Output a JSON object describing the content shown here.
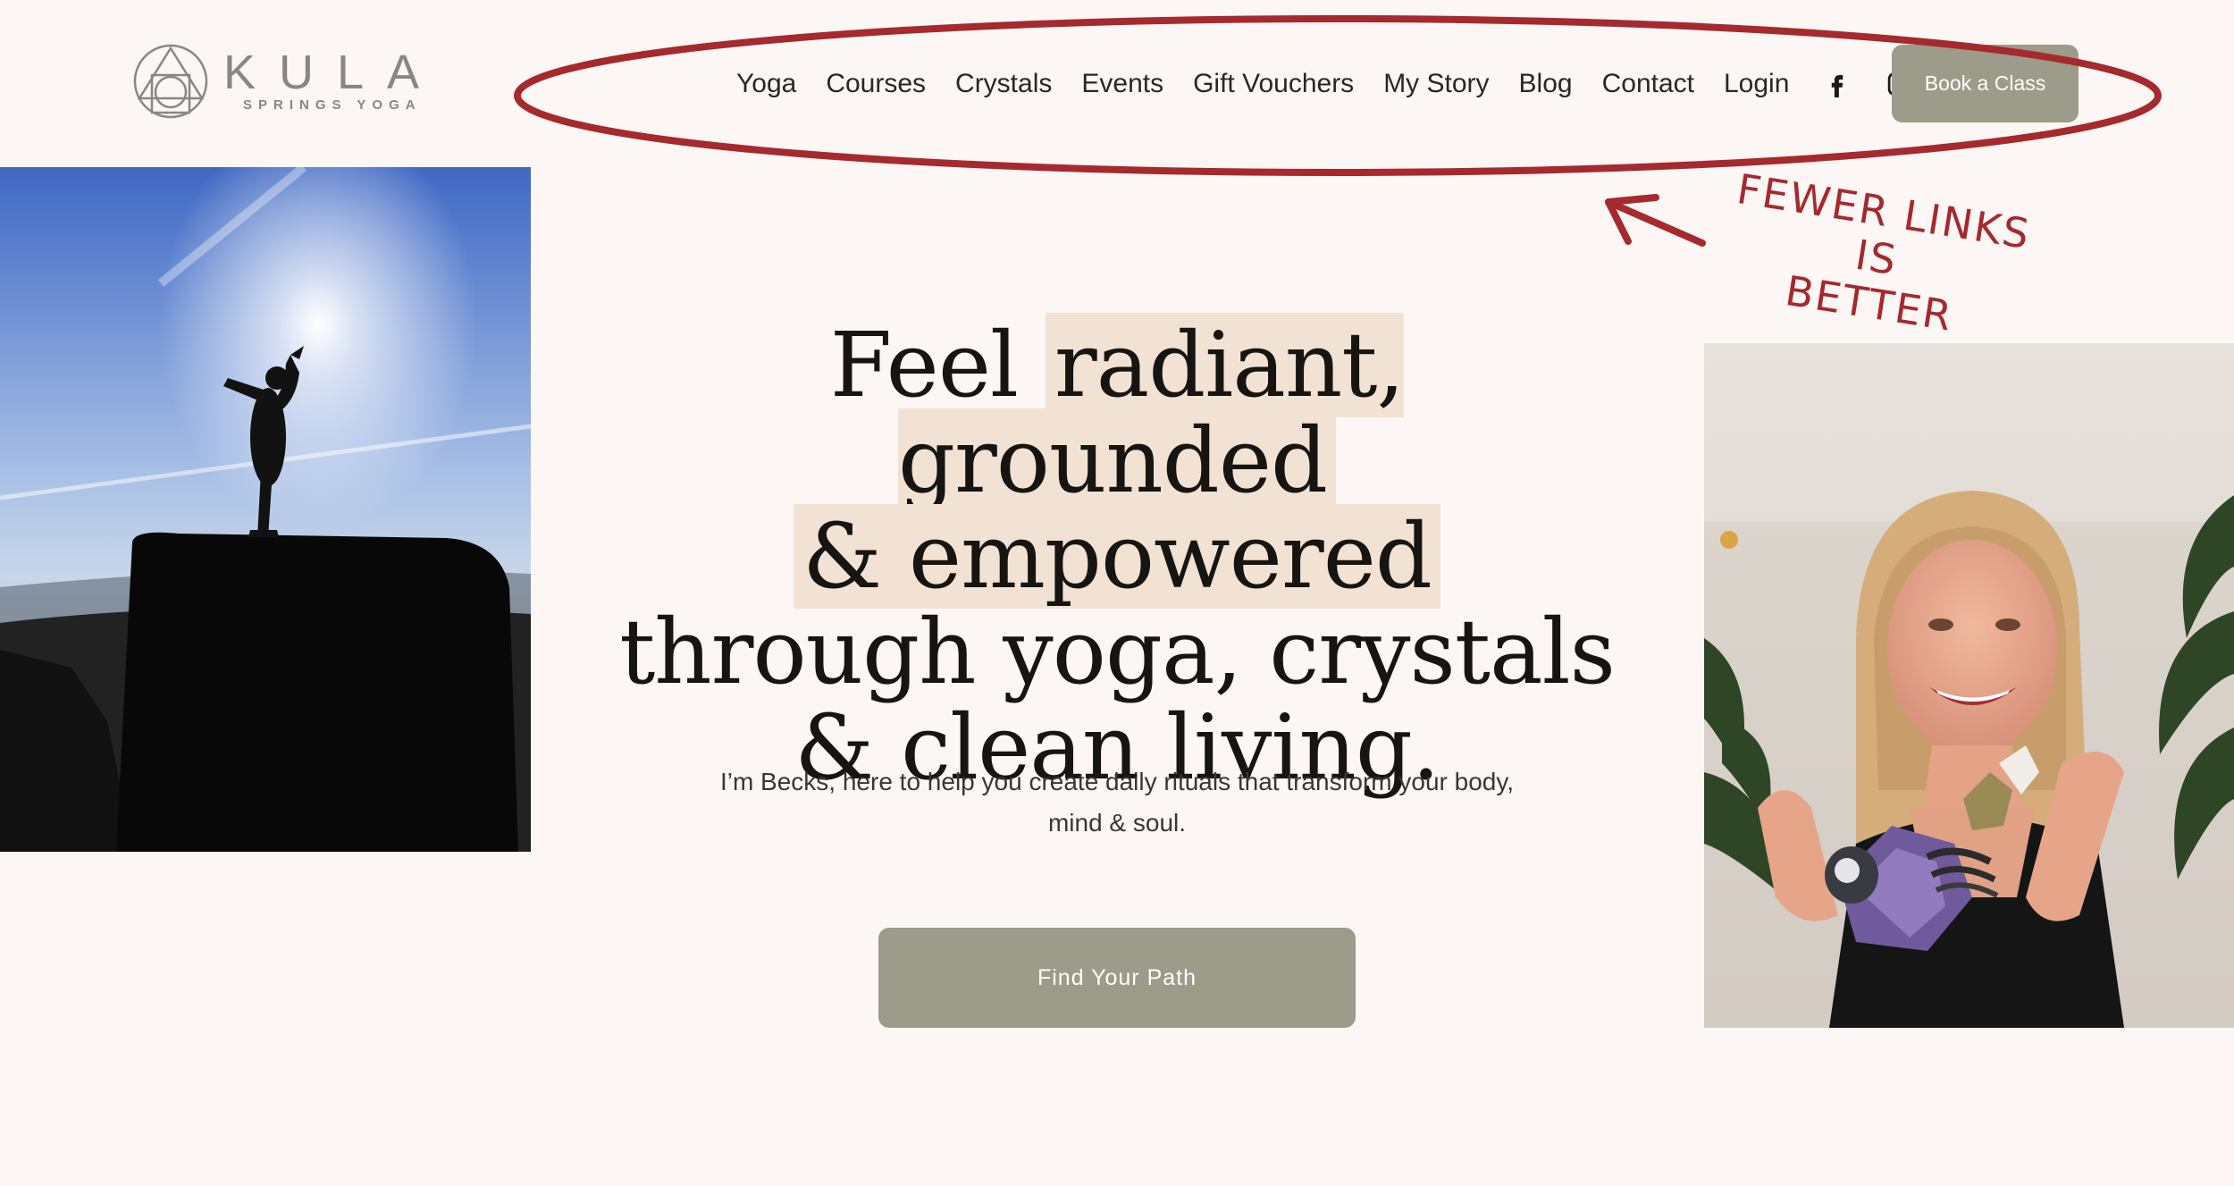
{
  "logo": {
    "word": "KULA",
    "sub": "SPRINGS YOGA"
  },
  "nav": {
    "links": [
      "Yoga",
      "Courses",
      "Crystals",
      "Events",
      "Gift Vouchers",
      "My Story",
      "Blog",
      "Contact",
      "Login"
    ],
    "social": [
      "facebook-icon",
      "instagram-icon"
    ],
    "book_label": "Book a Class"
  },
  "annotation": {
    "line1": "FEWER LINKS IS",
    "line2": "BETTER",
    "color": "#a6292e"
  },
  "hero": {
    "part1": "Feel ",
    "highlight1": "radiant, grounded",
    "highlight2": "& empowered",
    "part2": " through yoga, crystals & clean living."
  },
  "subtitle": "I’m Becks, here to help you create daily rituals that transform your body, mind & soul.",
  "cta_label": "Find Your Path",
  "colors": {
    "background": "#fcf7f5",
    "button": "#9d9b89",
    "highlight": "#f2e2d3"
  }
}
